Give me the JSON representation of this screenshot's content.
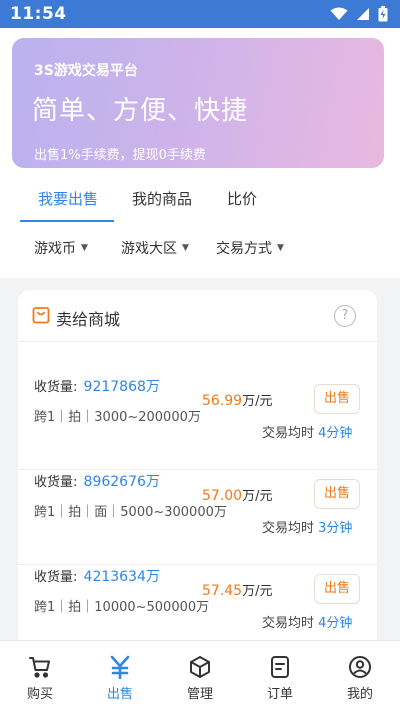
{
  "status_bar": {
    "time": "11:54"
  },
  "banner": {
    "subtitle": "3S游戏交易平台",
    "title": "简单、方便、快捷",
    "description": "出售1%手续费，提现0手续费"
  },
  "tabs": [
    {
      "label": "我要出售",
      "active": true
    },
    {
      "label": "我的商品",
      "active": false
    },
    {
      "label": "比价",
      "active": false
    }
  ],
  "filters": [
    {
      "label": "游戏币"
    },
    {
      "label": "游戏大区"
    },
    {
      "label": "交易方式"
    }
  ],
  "card": {
    "title": "卖给商城",
    "help_icon": "?",
    "listings": [
      {
        "volume_label": "收货量:",
        "volume": "9217868万",
        "tags": "跨1｜拍｜3000~200000万",
        "price": "56.99",
        "price_unit": "万/元",
        "sell_label": "出售",
        "time_label": "交易均时",
        "time": "4分钟"
      },
      {
        "volume_label": "收货量:",
        "volume": "8962676万",
        "tags": "跨1｜拍｜面｜5000~300000万",
        "price": "57.00",
        "price_unit": "万/元",
        "sell_label": "出售",
        "time_label": "交易均时",
        "time": "3分钟"
      },
      {
        "volume_label": "收货量:",
        "volume": "4213634万",
        "tags": "跨1｜拍｜10000~500000万",
        "price": "57.45",
        "price_unit": "万/元",
        "sell_label": "出售",
        "time_label": "交易均时",
        "time": "4分钟"
      }
    ]
  },
  "bottom_nav": [
    {
      "label": "购买",
      "icon": "cart-icon",
      "active": false
    },
    {
      "label": "出售",
      "icon": "yen-icon",
      "active": true
    },
    {
      "label": "管理",
      "icon": "box-icon",
      "active": false
    },
    {
      "label": "订单",
      "icon": "order-icon",
      "active": false
    },
    {
      "label": "我的",
      "icon": "user-icon",
      "active": false
    }
  ],
  "colors": {
    "accent": "#2e86e6",
    "price": "#f07a1a",
    "status_bar": "#3d7ad6"
  }
}
